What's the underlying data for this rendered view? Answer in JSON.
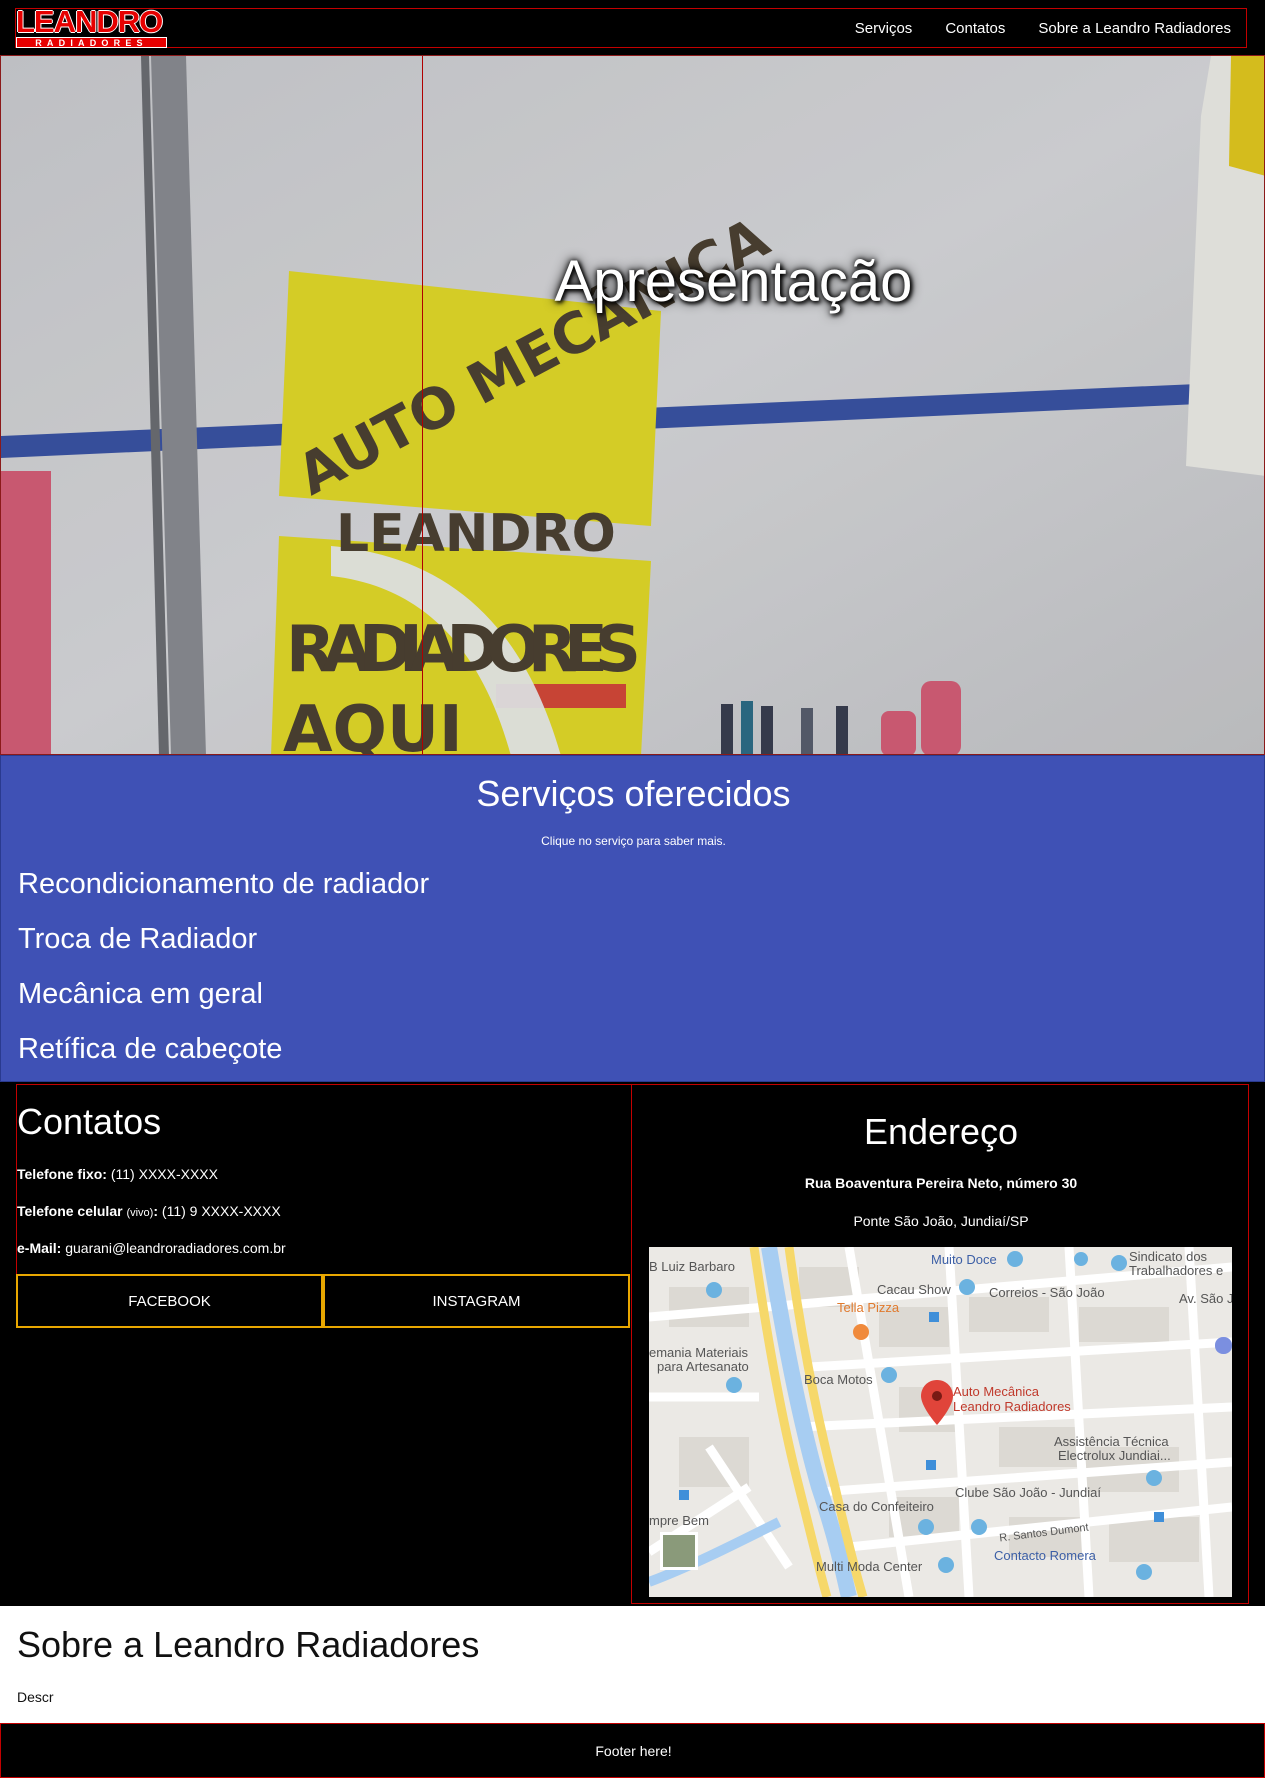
{
  "brand": {
    "logo_top": "LEANDRO",
    "logo_bottom": "RADIADORES",
    "accent_color": "#e60000"
  },
  "nav": {
    "items": [
      {
        "label": "Serviços"
      },
      {
        "label": "Contatos"
      },
      {
        "label": "Sobre a Leandro Radiadores"
      }
    ]
  },
  "hero": {
    "title": "Apresentação",
    "photo_sign_text": [
      "AUTO MECÂNICA",
      "LEANDRO",
      "RADIADORES",
      "AQUI"
    ]
  },
  "services": {
    "title": "Serviços oferecidos",
    "hint": "Clique no serviço para saber mais.",
    "items": [
      {
        "label": "Recondicionamento de radiador"
      },
      {
        "label": "Troca de Radiador"
      },
      {
        "label": "Mecânica em geral"
      },
      {
        "label": "Retífica de cabeçote"
      }
    ],
    "background_color": "#3f51b5"
  },
  "contacts": {
    "title": "Contatos",
    "phone_label": "Telefone fixo:",
    "phone_value": "(11) XXXX-XXXX",
    "mobile_label": "Telefone celular",
    "mobile_carrier": "(vivo)",
    "mobile_value": "(11) 9 XXXX-XXXX",
    "email_label": "e-Mail:",
    "email_value": "guarani@leandroradiadores.com.br",
    "facebook_label": "FACEBOOK",
    "instagram_label": "INSTAGRAM"
  },
  "address": {
    "title": "Endereço",
    "street": "Rua Boaventura Pereira Neto, número 30",
    "city": "Ponte São João, Jundiaí/SP",
    "map": {
      "marker_label_line1": "Auto Mecânica",
      "marker_label_line2": "Leandro Radiadores",
      "places": [
        "B Luiz Barbaro",
        "Muito Doce",
        "Sindicato dos",
        "Trabalhadores e",
        "Cacau Show",
        "Correios - São João",
        "Av. São Joã",
        "Tella Pizza",
        "emania Materiais",
        "para Artesanato",
        "Boca Motos",
        "Assistência Técnica",
        "Electrolux Jundiai...",
        "Clube São João - Jundiaí",
        "Casa do Confeiteiro",
        "mpre Bem",
        "R. Santos Dumont",
        "Multi Moda Center",
        "Contacto Romera"
      ]
    }
  },
  "about": {
    "title": "Sobre a Leandro Radiadores",
    "description": "Descr"
  },
  "footer": {
    "text": "Footer here!"
  }
}
